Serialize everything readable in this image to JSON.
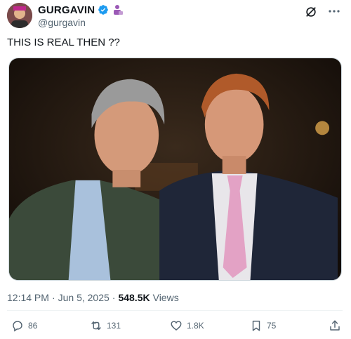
{
  "author": {
    "display_name": "GURGAVIN",
    "handle": "@gurgavin"
  },
  "tweet": {
    "text": "THIS IS REAL THEN ??"
  },
  "meta": {
    "time": "12:14 PM",
    "separator": "·",
    "date": "Jun 5, 2025",
    "views_count": "548.5K",
    "views_label": "Views"
  },
  "actions": {
    "replies": "86",
    "reposts": "131",
    "likes": "1.8K",
    "bookmarks": "75"
  },
  "icons": {
    "verified": "verified-badge-icon",
    "affiliate": "affiliate-badge-icon",
    "grok": "grok-icon",
    "more": "more-icon",
    "reply": "reply-icon",
    "repost": "repost-icon",
    "like": "like-icon",
    "bookmark": "bookmark-icon",
    "share": "share-icon"
  },
  "colors": {
    "verified_blue": "#1d9bf0",
    "affiliate_purple": "#9b59b6",
    "text_primary": "#0f1419",
    "text_secondary": "#536471"
  }
}
